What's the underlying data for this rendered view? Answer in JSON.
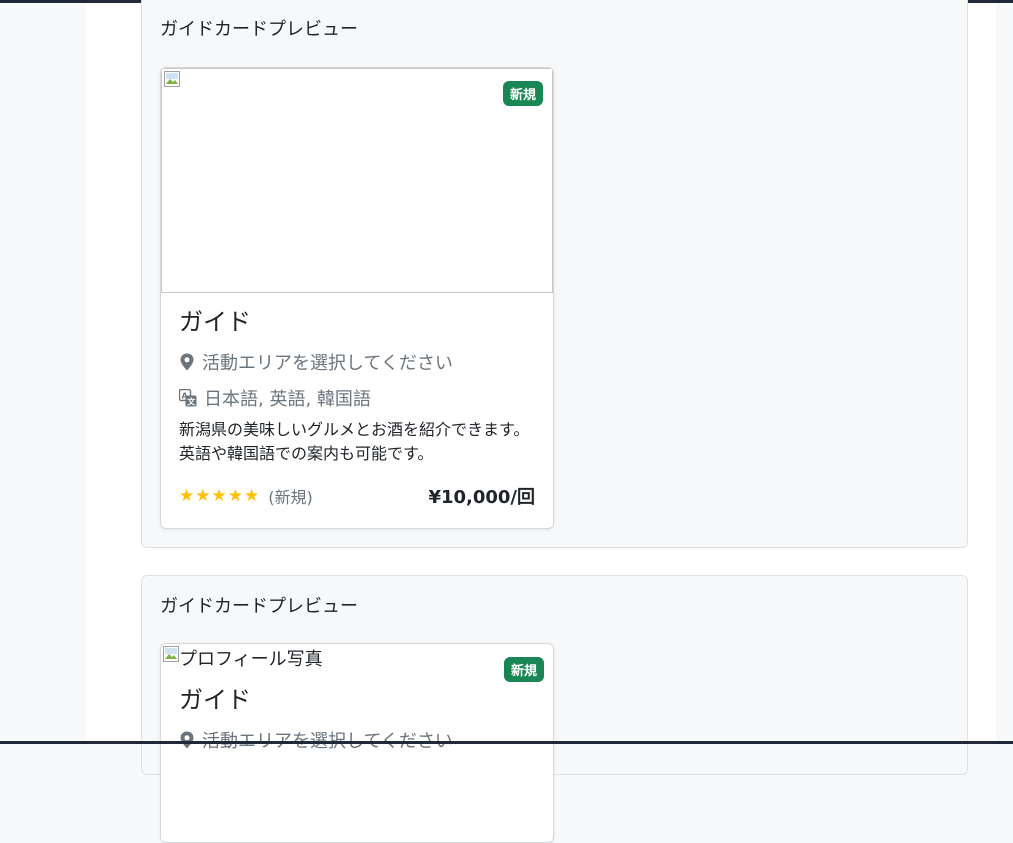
{
  "previews": [
    {
      "title": "ガイドカードプレビュー",
      "badge": "新規",
      "photo_alt": "",
      "guide_name": "ガイド",
      "area": "活動エリアを選択してください",
      "languages": "日本語, 英語, 韓国語",
      "description": "新潟県の美味しいグルメとお酒を紹介できます。英語や韓国語での案内も可能です。",
      "stars": "★★★★★",
      "rating_text": "(新規)",
      "price": "¥10,000/回"
    },
    {
      "title": "ガイドカードプレビュー",
      "badge": "新規",
      "photo_alt": "プロフィール写真",
      "guide_name": "ガイド",
      "area": "活動エリアを選択してください"
    }
  ],
  "colors": {
    "badge": "#198754",
    "star": "#ffc107",
    "muted": "#6c757d"
  },
  "icons": {
    "location": "map-pin-icon",
    "language": "translate-icon",
    "broken_image": "broken-image-icon"
  }
}
